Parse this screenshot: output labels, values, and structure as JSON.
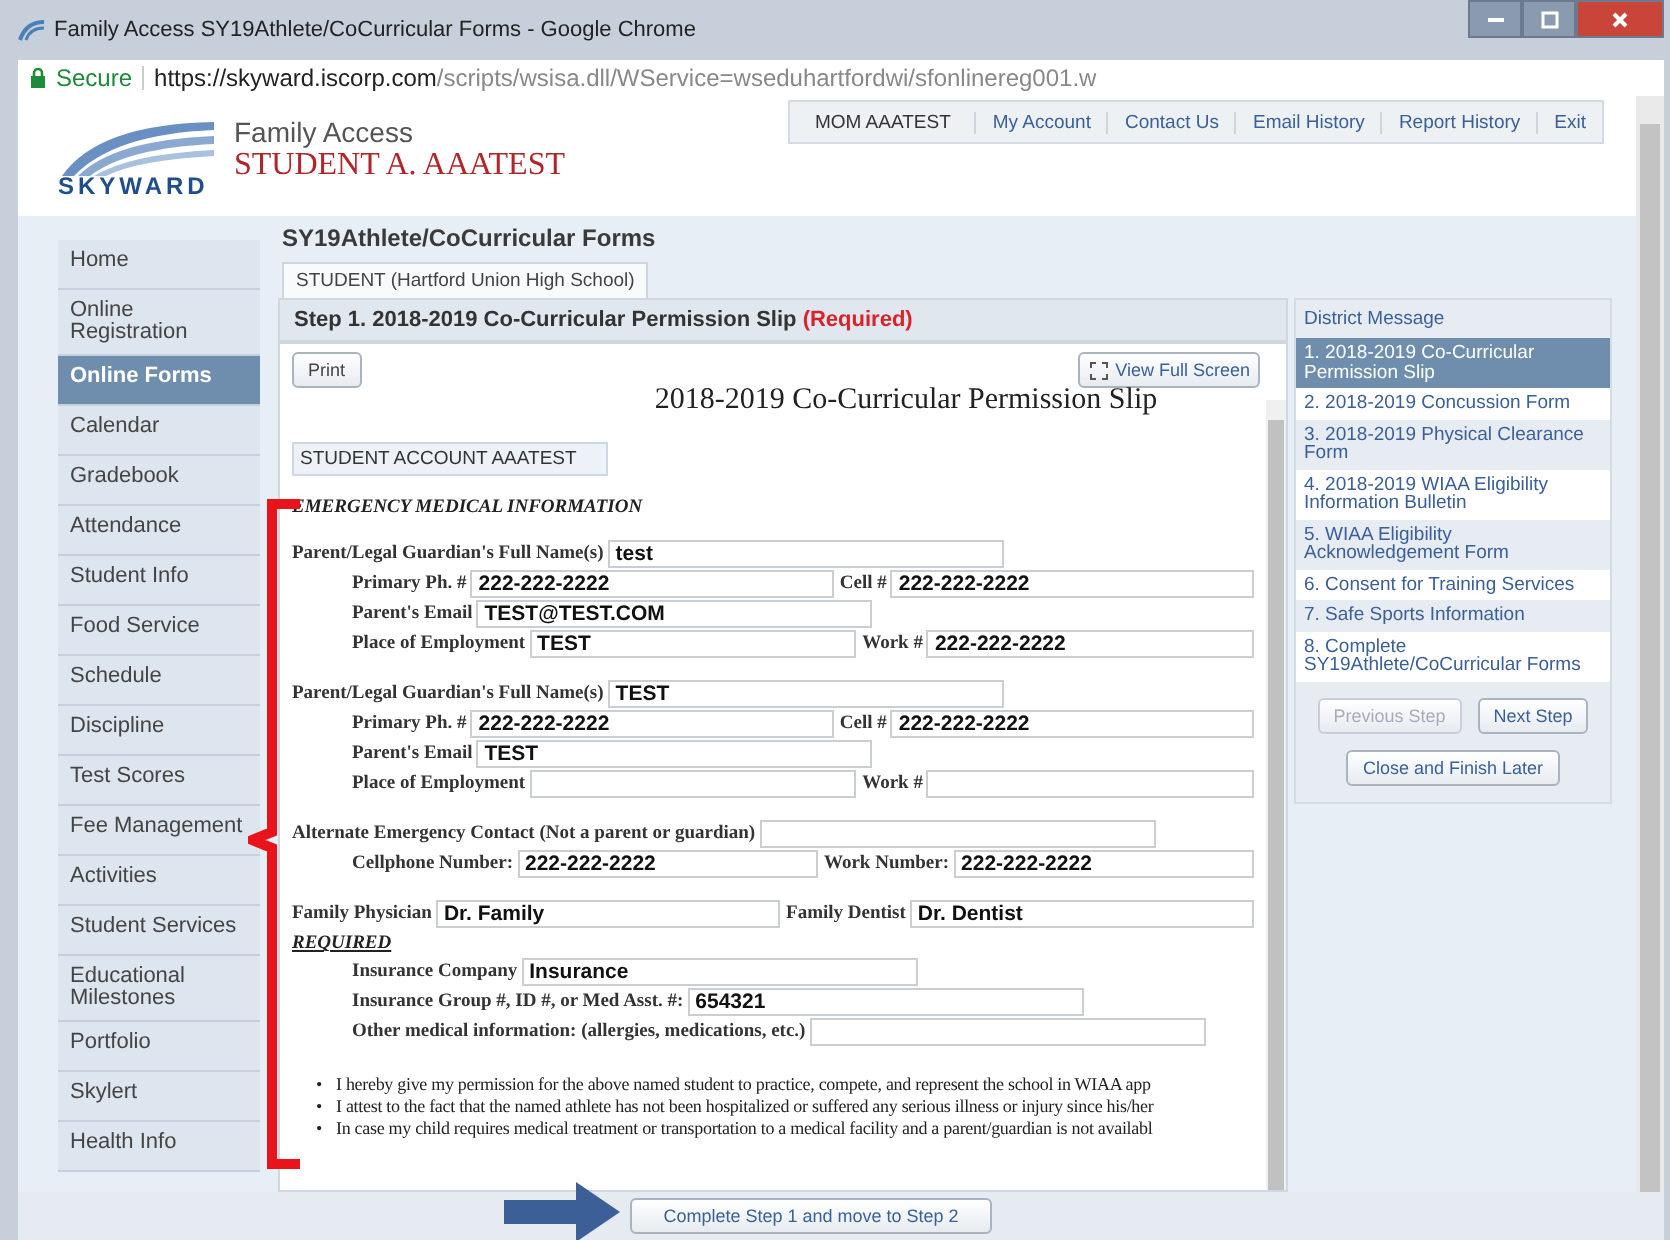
{
  "window": {
    "title": "Family Access SY19Athlete/CoCurricular Forms - Google Chrome"
  },
  "address_bar": {
    "secure_label": "Secure",
    "url_host": "https://skyward.iscorp.com",
    "url_path": "/scripts/wsisa.dll/WService=wseduhartfordwi/sfonlinereg001.w"
  },
  "header": {
    "logo": "SKYWARD",
    "app_name": "Family Access",
    "student_name": "STUDENT A. AAATEST",
    "user": "MOM AAATEST",
    "links": [
      "My Account",
      "Contact Us",
      "Email History",
      "Report History",
      "Exit"
    ]
  },
  "sidebar": {
    "items": [
      {
        "label": "Home",
        "selected": false
      },
      {
        "label": "Online Registration",
        "selected": false
      },
      {
        "label": "Online Forms",
        "selected": true
      },
      {
        "label": "Calendar",
        "selected": false
      },
      {
        "label": "Gradebook",
        "selected": false
      },
      {
        "label": "Attendance",
        "selected": false
      },
      {
        "label": "Student Info",
        "selected": false
      },
      {
        "label": "Food Service",
        "selected": false
      },
      {
        "label": "Schedule",
        "selected": false
      },
      {
        "label": "Discipline",
        "selected": false
      },
      {
        "label": "Test Scores",
        "selected": false
      },
      {
        "label": "Fee Management",
        "selected": false
      },
      {
        "label": "Activities",
        "selected": false
      },
      {
        "label": "Student Services",
        "selected": false
      },
      {
        "label": "Educational Milestones",
        "selected": false
      },
      {
        "label": "Portfolio",
        "selected": false
      },
      {
        "label": "Skylert",
        "selected": false
      },
      {
        "label": "Health Info",
        "selected": false
      }
    ]
  },
  "page_title": "SY19Athlete/CoCurricular Forms",
  "tabs": [
    {
      "label": "STUDENT (Hartford Union High School)",
      "selected": true
    }
  ],
  "step": {
    "title": "Step 1. 2018-2019 Co-Curricular Permission Slip",
    "required": "(Required)"
  },
  "print_button": "Print",
  "full_screen_button": "View Full Screen",
  "form": {
    "title": "2018-2019 Co-Curricular Permission Slip",
    "student": "STUDENT ACCOUNT AAATEST",
    "groups": [
      {
        "rows": [
          {
            "kind": "heading",
            "text": "EMERGENCY MEDICAL INFORMATION"
          }
        ]
      },
      {
        "rows": [
          {
            "kind": "fields",
            "fields": [
              {
                "label": "Parent/Legal Guardian's Full Name(s)",
                "value": "test"
              }
            ],
            "children": [
              {
                "kind": "fields",
                "fields": [
                  {
                    "label": "Primary Ph. #",
                    "value": "222-222-2222"
                  },
                  {
                    "label": "Cell #",
                    "value": "222-222-2222"
                  }
                ]
              },
              {
                "kind": "fields",
                "fields": [
                  {
                    "label": "Parent's Email",
                    "value": "TEST@TEST.COM"
                  }
                ]
              },
              {
                "kind": "fields",
                "fields": [
                  {
                    "label": "Place of Employment",
                    "value": "TEST"
                  },
                  {
                    "label": "Work #",
                    "value": "222-222-2222"
                  }
                ]
              }
            ]
          }
        ]
      },
      {
        "rows": [
          {
            "kind": "fields",
            "fields": [
              {
                "label": "Parent/Legal Guardian's Full Name(s)",
                "value": "TEST"
              }
            ],
            "children": [
              {
                "kind": "fields",
                "fields": [
                  {
                    "label": "Primary Ph. #",
                    "value": "222-222-2222"
                  },
                  {
                    "label": "Cell #",
                    "value": "222-222-2222"
                  }
                ]
              },
              {
                "kind": "fields",
                "fields": [
                  {
                    "label": "Parent's Email",
                    "value": "TEST"
                  }
                ]
              },
              {
                "kind": "fields",
                "fields": [
                  {
                    "label": "Place of Employment"
                  },
                  {
                    "label": "Work #"
                  }
                ]
              }
            ]
          }
        ]
      },
      {
        "rows": [
          {
            "kind": "fields",
            "fields": [
              {
                "label": "Alternate Emergency Contact (Not a parent or guardian)"
              }
            ],
            "children": [
              {
                "kind": "fields",
                "fields": [
                  {
                    "label": "Cellphone Number:",
                    "value": "222-222-2222"
                  },
                  {
                    "label": "Work Number:",
                    "value": "222-222-2222"
                  }
                ]
              }
            ]
          }
        ]
      },
      {
        "rows": [
          {
            "kind": "fields",
            "fields": [
              {
                "label": "Family Physician",
                "value": "Dr. Family"
              },
              {
                "label": "Family Dentist",
                "value": "Dr. Dentist"
              }
            ]
          },
          {
            "kind": "subheading",
            "text": "REQUIRED",
            "children": [
              {
                "kind": "fields",
                "fields": [
                  {
                    "label": "Insurance Company",
                    "value": "Insurance"
                  }
                ]
              },
              {
                "kind": "fields",
                "fields": [
                  {
                    "label": "Insurance Group #, ID #, or Med Asst. #:",
                    "value": "654321"
                  }
                ]
              },
              {
                "kind": "fields",
                "fields": [
                  {
                    "label": "Other medical information: (allergies, medications, etc.)"
                  }
                ]
              }
            ]
          }
        ]
      }
    ],
    "bullets": [
      {
        "marker": "•",
        "text": "I hereby give my permission for the above named student to practice, compete, and represent the school in WIAA app"
      },
      {
        "marker": "•",
        "text": "I attest to the fact that the named athlete has not been hospitalized or suffered any serious illness or injury since his/her"
      },
      {
        "marker": "•",
        "text": "In case my child requires medical treatment or transportation to a medical facility and a parent/guardian is not availabl"
      }
    ]
  },
  "complete_button": "Complete Step 1 and move to Step 2",
  "steps_panel": {
    "heading": "District Message",
    "steps": [
      {
        "label": "1. 2018-2019 Co-Curricular Permission Slip",
        "selected": true
      },
      {
        "label": "2. 2018-2019 Concussion Form",
        "selected": false
      },
      {
        "label": "3. 2018-2019 Physical Clearance Form",
        "selected": false
      },
      {
        "label": "4. 2018-2019 WIAA Eligibility Information Bulletin",
        "selected": false
      },
      {
        "label": "5. WIAA Eligibility Acknowledgement Form",
        "selected": false
      },
      {
        "label": "6. Consent for Training Services",
        "selected": false
      },
      {
        "label": "7. Safe Sports Information",
        "selected": false
      },
      {
        "label": "8. Complete SY19Athlete/CoCurricular Forms",
        "selected": false
      }
    ]
  },
  "step_buttons": [
    {
      "label": "Previous Step",
      "disabled": true
    },
    {
      "label": "Next Step",
      "disabled": false
    }
  ],
  "finish_button": "Close and Finish Later"
}
